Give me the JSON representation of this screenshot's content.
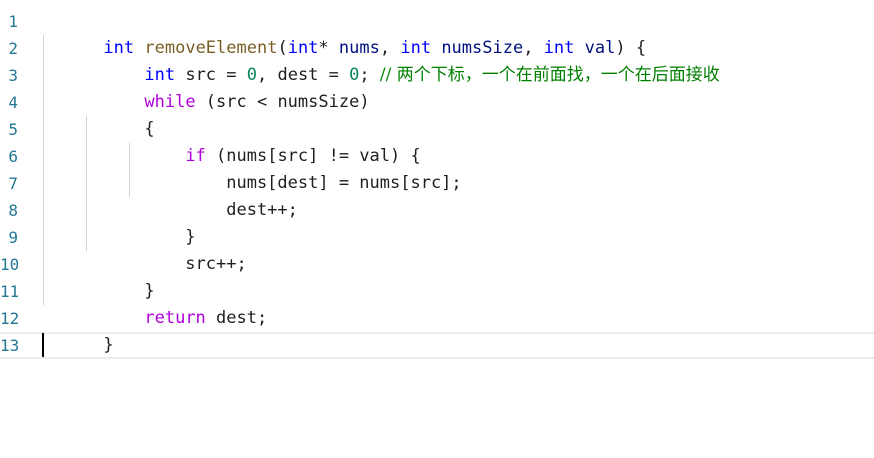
{
  "editor": {
    "line_numbers": [
      "1",
      "2",
      "3",
      "4",
      "5",
      "6",
      "7",
      "8",
      "9",
      "10",
      "11",
      "12",
      "13"
    ],
    "lines": [
      {
        "tokens": [
          {
            "text": "int",
            "type": "kw"
          },
          {
            "text": " ",
            "type": "plain"
          },
          {
            "text": "removeElement",
            "type": "fn"
          },
          {
            "text": "(",
            "type": "plain"
          },
          {
            "text": "int",
            "type": "kw"
          },
          {
            "text": "* ",
            "type": "plain"
          },
          {
            "text": "nums",
            "type": "var"
          },
          {
            "text": ", ",
            "type": "plain"
          },
          {
            "text": "int",
            "type": "kw"
          },
          {
            "text": " ",
            "type": "plain"
          },
          {
            "text": "numsSize",
            "type": "var"
          },
          {
            "text": ", ",
            "type": "plain"
          },
          {
            "text": "int",
            "type": "kw"
          },
          {
            "text": " ",
            "type": "plain"
          },
          {
            "text": "val",
            "type": "var"
          },
          {
            "text": ") {",
            "type": "plain"
          }
        ]
      },
      {
        "tokens": [
          {
            "text": "    ",
            "type": "plain"
          },
          {
            "text": "int",
            "type": "kw"
          },
          {
            "text": " src = ",
            "type": "plain"
          },
          {
            "text": "0",
            "type": "num"
          },
          {
            "text": ", dest = ",
            "type": "plain"
          },
          {
            "text": "0",
            "type": "num"
          },
          {
            "text": "; ",
            "type": "plain"
          },
          {
            "text": "// 两个下标，一个在前面找，一个在后面接收",
            "type": "cmt"
          }
        ]
      },
      {
        "tokens": [
          {
            "text": "    ",
            "type": "plain"
          },
          {
            "text": "while",
            "type": "ctl"
          },
          {
            "text": " (src < numsSize)",
            "type": "plain"
          }
        ]
      },
      {
        "tokens": [
          {
            "text": "    {",
            "type": "plain"
          }
        ]
      },
      {
        "tokens": [
          {
            "text": "        ",
            "type": "plain"
          },
          {
            "text": "if",
            "type": "ctl"
          },
          {
            "text": " (nums[src] != val) {",
            "type": "plain"
          }
        ]
      },
      {
        "tokens": [
          {
            "text": "            nums[dest] = nums[src];",
            "type": "plain"
          }
        ]
      },
      {
        "tokens": [
          {
            "text": "            dest++;",
            "type": "plain"
          }
        ]
      },
      {
        "tokens": [
          {
            "text": "        }",
            "type": "plain"
          }
        ]
      },
      {
        "tokens": [
          {
            "text": "        src++;",
            "type": "plain"
          }
        ]
      },
      {
        "tokens": [
          {
            "text": "    }",
            "type": "plain"
          }
        ]
      },
      {
        "tokens": [
          {
            "text": "    ",
            "type": "plain"
          },
          {
            "text": "return",
            "type": "ctl"
          },
          {
            "text": " dest;",
            "type": "plain"
          }
        ]
      },
      {
        "tokens": [
          {
            "text": "}",
            "type": "plain"
          }
        ]
      },
      {
        "tokens": []
      }
    ]
  },
  "colors": {
    "keyword": "#0000ff",
    "control": "#af00db",
    "function": "#795e26",
    "comment": "#008000",
    "number": "#098658",
    "line_number": "#237893"
  }
}
